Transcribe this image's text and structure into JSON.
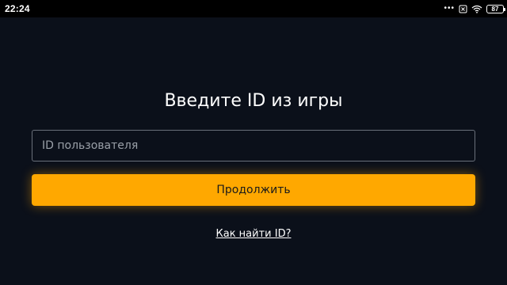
{
  "status_bar": {
    "time": "22:24",
    "battery_level": "87",
    "icons": [
      "more-dots-icon",
      "no-sim-icon",
      "wifi-icon",
      "battery-icon"
    ]
  },
  "form": {
    "title": "Введите ID из игры",
    "input_placeholder": "ID пользователя",
    "input_value": "",
    "continue_label": "Продолжить",
    "help_link": "Как найти ID?"
  },
  "colors": {
    "background": "#0b101a",
    "accent": "#ffa800",
    "text": "#ffffff"
  }
}
